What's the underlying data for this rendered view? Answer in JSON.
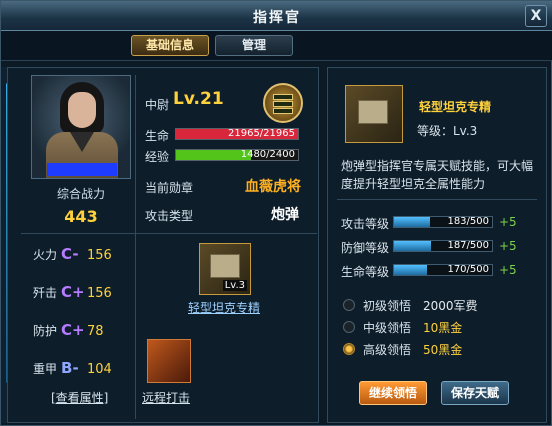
{
  "window": {
    "title": "指挥官",
    "close_label": "X"
  },
  "tabs": [
    {
      "label": "基础信息"
    },
    {
      "label": "管理"
    }
  ],
  "commander": {
    "power_label": "综合战力",
    "power_value": "443",
    "rank_label": "中尉",
    "level": "Lv.21",
    "hp_label": "生命",
    "hp_text": "21965/21965",
    "hp_fraction": 1.0,
    "exp_label": "经验",
    "exp_text": "1480/2400",
    "exp_fraction": 0.617,
    "medal_label": "当前勋章",
    "medal_value": "血薇虎将",
    "attack_type_label": "攻击类型",
    "attack_type_value": "炮弹"
  },
  "stats": [
    {
      "label": "火力",
      "grade": "C-",
      "value": "156"
    },
    {
      "label": "歼击",
      "grade": "C+",
      "value": "156"
    },
    {
      "label": "防护",
      "grade": "C+",
      "value": "78"
    },
    {
      "label": "重甲",
      "grade": "B-",
      "value": "104"
    }
  ],
  "view_attributes_link": "[查看属性]",
  "skills": [
    {
      "name": "轻型坦克专精",
      "tag": "Lv.3"
    },
    {
      "name": "远程打击"
    }
  ],
  "detail": {
    "title": "轻型坦克专精",
    "level_text": "等级：Lv.3",
    "description": "炮弹型指挥官专属天赋技能，可大幅度提升轻型坦克全属性能力",
    "levels": [
      {
        "label": "攻击等级",
        "text": "183/500",
        "fraction": 0.366,
        "plus": "+5"
      },
      {
        "label": "防御等级",
        "text": "187/500",
        "fraction": 0.374,
        "plus": "+5"
      },
      {
        "label": "生命等级",
        "text": "170/500",
        "fraction": 0.34,
        "plus": "+5"
      }
    ],
    "options": [
      {
        "label": "初级领悟",
        "cost": "2000军费",
        "selected": false
      },
      {
        "label": "中级领悟",
        "cost": "10黑金",
        "selected": false
      },
      {
        "label": "高级领悟",
        "cost": "50黑金",
        "selected": true
      }
    ],
    "continue_button": "继续领悟",
    "save_button": "保存天赋"
  },
  "colors": {
    "hp_bar": "#d8263a",
    "exp_bar": "#52c41a",
    "accent_gold": "#ffd23c"
  }
}
